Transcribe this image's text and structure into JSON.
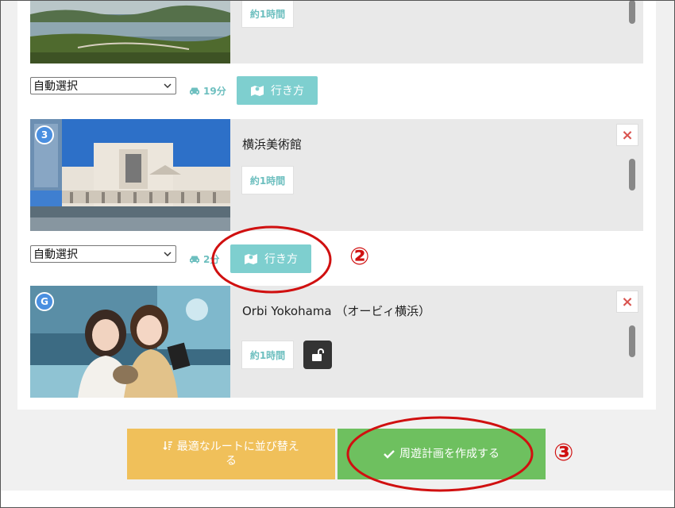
{
  "cards": [
    {
      "title": "",
      "duration": "約1時間"
    },
    {
      "number": "3",
      "title": "横浜美術館",
      "duration": "約1時間",
      "close": "×"
    },
    {
      "number": "G",
      "title": "Orbi Yokohama （オービィ横浜）",
      "duration": "約1時間",
      "close": "×"
    }
  ],
  "legs": [
    {
      "mode": "自動選択",
      "time": "19分",
      "directions": "行き方"
    },
    {
      "mode": "自動選択",
      "time": "2分",
      "directions": "行き方"
    }
  ],
  "bottom": {
    "sort_label": "最適なルートに並び替える",
    "create_label": "周遊計画を作成する"
  },
  "annotations": {
    "two": "②",
    "three": "③"
  },
  "colors": {
    "teal": "#7ecfcf",
    "teal_text": "#6dbfbf",
    "orange": "#f0c05a",
    "green": "#6ec05f",
    "red_annotation": "#d01010",
    "badge_blue": "#4a8fe0"
  },
  "icons": [
    "car-icon",
    "map-icon",
    "close-icon",
    "unlock-icon",
    "sort-icon",
    "check-icon",
    "chevron-down-icon"
  ]
}
